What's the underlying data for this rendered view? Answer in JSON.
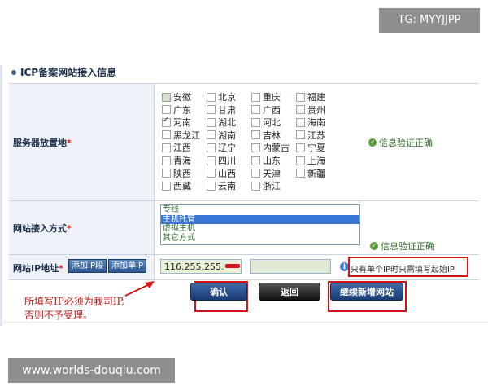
{
  "watermark_top": "TG: MYYJJPP",
  "watermark_bottom": "www.worlds-douqiu.com",
  "section_title": "ICP备案网站接入信息",
  "server_location": {
    "label": "服务器放置地",
    "required_mark": "*",
    "provinces": [
      {
        "name": "安徽",
        "state": "gray"
      },
      {
        "name": "北京",
        "state": "unchecked"
      },
      {
        "name": "重庆",
        "state": "unchecked"
      },
      {
        "name": "福建",
        "state": "unchecked"
      },
      {
        "name": "广东",
        "state": "unchecked"
      },
      {
        "name": "甘肃",
        "state": "unchecked"
      },
      {
        "name": "广西",
        "state": "unchecked"
      },
      {
        "name": "贵州",
        "state": "unchecked"
      },
      {
        "name": "河南",
        "state": "checked"
      },
      {
        "name": "湖北",
        "state": "unchecked"
      },
      {
        "name": "河北",
        "state": "unchecked"
      },
      {
        "name": "海南",
        "state": "unchecked"
      },
      {
        "name": "黑龙江",
        "state": "unchecked"
      },
      {
        "name": "湖南",
        "state": "unchecked"
      },
      {
        "name": "吉林",
        "state": "unchecked"
      },
      {
        "name": "江苏",
        "state": "unchecked"
      },
      {
        "name": "江西",
        "state": "unchecked"
      },
      {
        "name": "辽宁",
        "state": "unchecked"
      },
      {
        "name": "内蒙古",
        "state": "unchecked"
      },
      {
        "name": "宁夏",
        "state": "unchecked"
      },
      {
        "name": "青海",
        "state": "unchecked"
      },
      {
        "name": "四川",
        "state": "unchecked"
      },
      {
        "name": "山东",
        "state": "unchecked"
      },
      {
        "name": "上海",
        "state": "unchecked"
      },
      {
        "name": "陕西",
        "state": "unchecked"
      },
      {
        "name": "山西",
        "state": "unchecked"
      },
      {
        "name": "天津",
        "state": "unchecked"
      },
      {
        "name": "新疆",
        "state": "unchecked"
      },
      {
        "name": "西藏",
        "state": "unchecked"
      },
      {
        "name": "云南",
        "state": "unchecked"
      },
      {
        "name": "浙江",
        "state": "unchecked"
      }
    ],
    "verify_text": "信息验证正确"
  },
  "access_method": {
    "label": "网站接入方式",
    "required_mark": "*",
    "options": [
      "专线",
      "主机托管",
      "虚拟主机",
      "其它方式"
    ],
    "selected": "主机托管",
    "verify_text": "信息验证正确"
  },
  "ip_address": {
    "label": "网站IP地址",
    "required_mark": "*",
    "btn_add_segment": "添加IP段",
    "btn_add_single": "添加单IP",
    "start_ip_value": "116.255.255.",
    "end_ip_value": "",
    "hint": "只有单个IP时只需填写起始IP"
  },
  "actions": {
    "confirm": "确认",
    "back": "返回",
    "continue_add": "继续新增网站"
  },
  "note_lines": [
    "所填写IP必须为我司IP,",
    "否则不予受理。"
  ],
  "colors": {
    "accent": "#1d2f4a",
    "annotation_red": "#d31414",
    "verify_green": "#2f6e2a"
  }
}
